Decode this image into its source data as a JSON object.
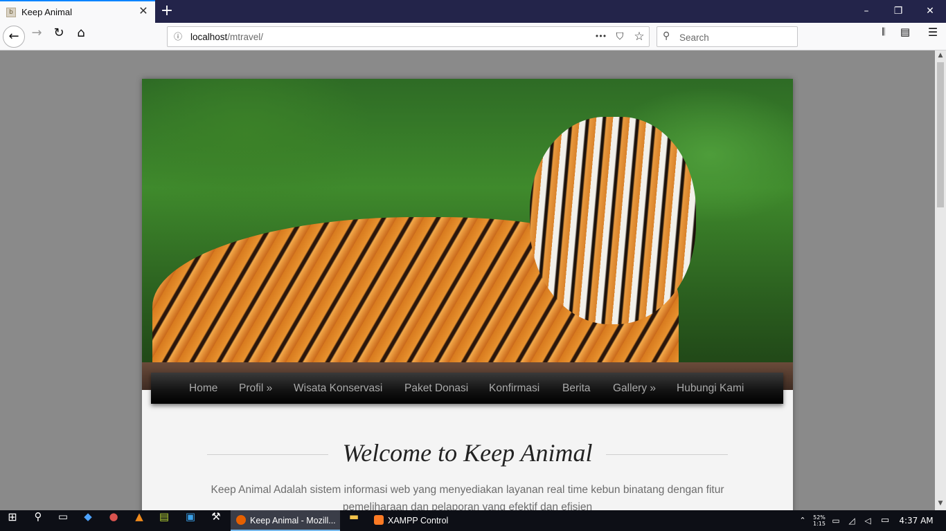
{
  "browser": {
    "tab": {
      "title": "Keep Animal",
      "favicon_letter": "b",
      "close_glyph": "✕"
    },
    "new_tab_glyph": "+",
    "window_controls": {
      "minimize": "–",
      "restore": "❐",
      "close": "✕"
    },
    "nav": {
      "back": "←",
      "forward": "→",
      "reload": "↻",
      "home": "⌂"
    },
    "url": {
      "host": "localhost",
      "path": "/mtravel/"
    },
    "url_icons": {
      "info": "ⓘ",
      "more": "•••",
      "pocket": "⛉",
      "bookmark": "☆"
    },
    "search": {
      "placeholder": "Search"
    },
    "toolbar_right": {
      "library": "𝄃",
      "sidebar": "▤",
      "menu": "☰"
    }
  },
  "site": {
    "menu": [
      {
        "label": "Home"
      },
      {
        "label": "Profil »"
      },
      {
        "label": "Wisata Konservasi"
      },
      {
        "label": "Paket Donasi"
      },
      {
        "label": "Konfirmasi"
      },
      {
        "label": "Berita"
      },
      {
        "label": "Gallery »"
      },
      {
        "label": "Hubungi Kami"
      }
    ],
    "welcome_title": "Welcome to Keep Animal",
    "description": "Keep Animal Adalah sistem informasi web yang menyediakan layanan real time kebun binatang dengan fitur pemeliharaan dan pelaporan yang efektif dan efisien"
  },
  "taskbar": {
    "apps": [
      {
        "label": "Keep Animal - Mozill...",
        "color": "#e66000"
      },
      {
        "label": "XAMPP Control Panel...",
        "color": "#fb7a24"
      }
    ],
    "tray": {
      "time": "4:37 AM",
      "battery_line1": "52%",
      "battery_line2": "1:15"
    }
  },
  "colors": {
    "accent_tab": "#0a84ff",
    "titlebar": "#23244a",
    "menu_text": "#a9a9a9"
  }
}
